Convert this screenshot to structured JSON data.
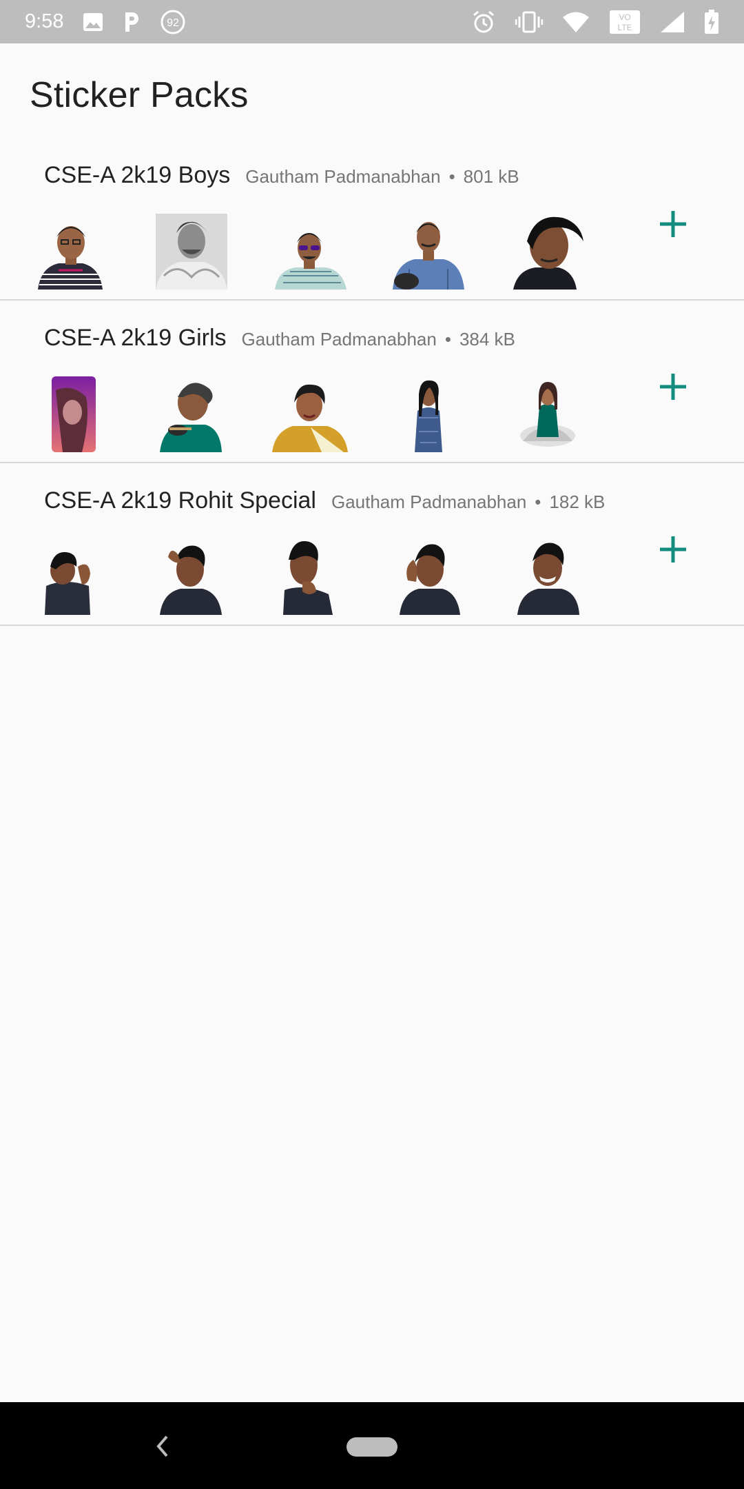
{
  "status_bar": {
    "time": "9:58",
    "notification_badge": "92",
    "volte_label_top": "VO",
    "volte_label_bottom": "LTE",
    "icons": [
      "image-icon",
      "parking-p-icon",
      "badge-92-icon",
      "alarm-icon",
      "vibrate-icon",
      "wifi-icon",
      "volte-icon",
      "signal-icon",
      "battery-charging-icon"
    ]
  },
  "header": {
    "title": "Sticker Packs"
  },
  "accent_color": "#128c7e",
  "packs": [
    {
      "name": "CSE-A 2k19 Boys",
      "publisher": "Gautham Padmanabhan",
      "separator": "•",
      "size": "801 kB",
      "stickers": [
        "sticker-photo-1",
        "sticker-photo-2",
        "sticker-photo-3",
        "sticker-photo-4",
        "sticker-photo-5"
      ]
    },
    {
      "name": "CSE-A 2k19 Girls",
      "publisher": "Gautham Padmanabhan",
      "separator": "•",
      "size": "384 kB",
      "stickers": [
        "sticker-photo-1",
        "sticker-photo-2",
        "sticker-photo-3",
        "sticker-photo-4",
        "sticker-photo-5"
      ]
    },
    {
      "name": "CSE-A 2k19 Rohit Special",
      "publisher": "Gautham Padmanabhan",
      "separator": "•",
      "size": "182 kB",
      "stickers": [
        "sticker-photo-1",
        "sticker-photo-2",
        "sticker-photo-3",
        "sticker-photo-4",
        "sticker-photo-5"
      ]
    }
  ],
  "nav_bar": {
    "icons": [
      "back-icon",
      "home-pill-icon"
    ]
  }
}
